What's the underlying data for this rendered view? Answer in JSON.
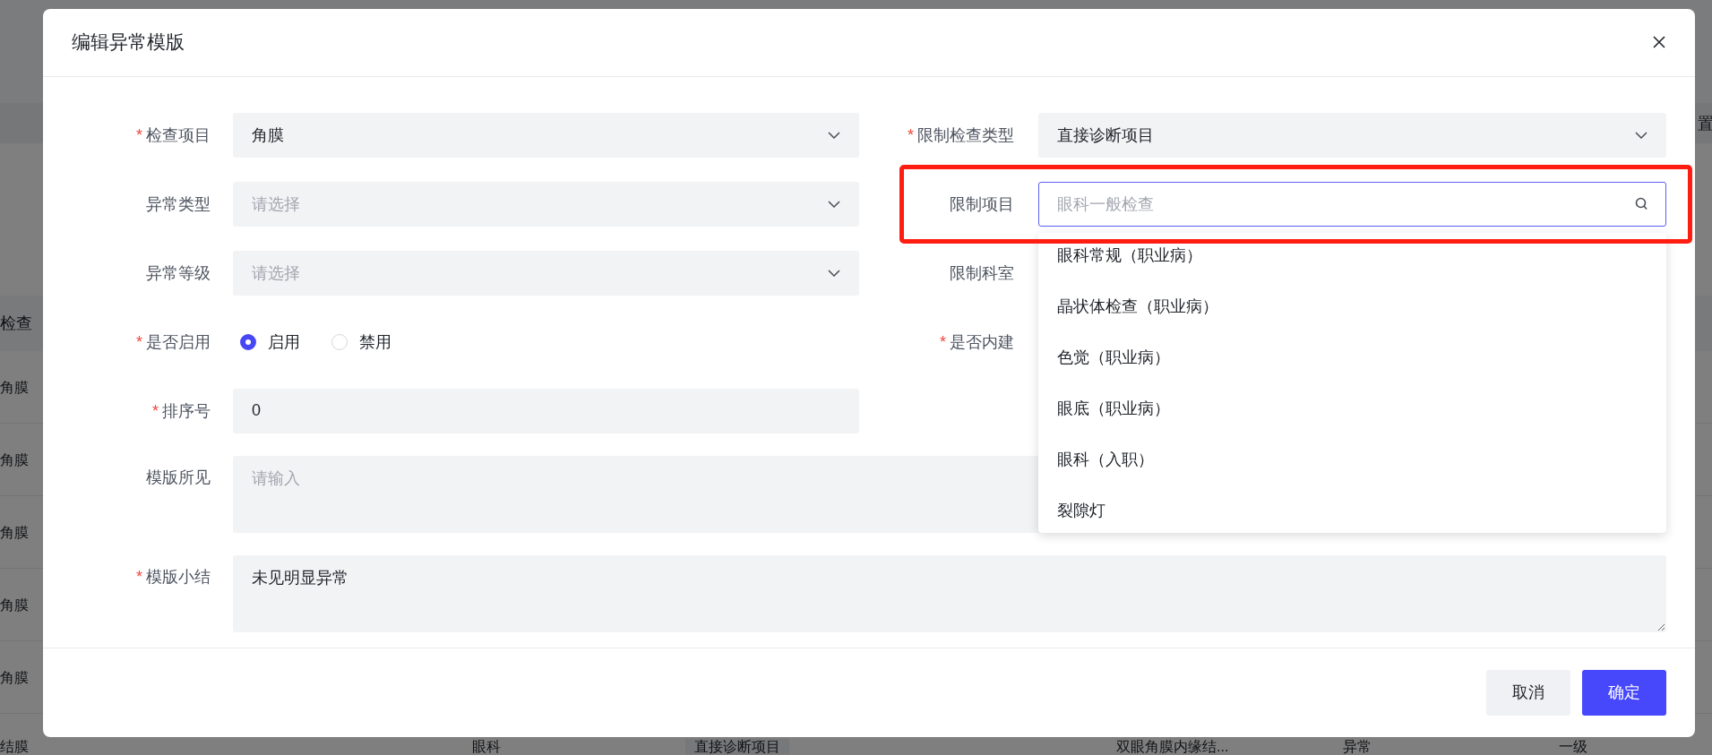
{
  "background": {
    "toolbar_text": "置",
    "table": {
      "header": "检查",
      "rows": [
        {
          "cells": [
            "角膜"
          ]
        },
        {
          "cells": [
            "角膜"
          ]
        },
        {
          "cells": [
            "角膜"
          ]
        },
        {
          "cells": [
            "角膜"
          ]
        },
        {
          "cells": [
            "角膜"
          ]
        },
        {
          "cells": [
            "结膜",
            "眼科",
            "直接诊断项目",
            "双眼角膜内缘结...",
            "异常",
            "一级"
          ]
        }
      ]
    }
  },
  "dialog": {
    "title": "编辑异常模版",
    "fields_left": [
      {
        "kind": "select",
        "label": "检查项目",
        "required_mark": "*",
        "value": "角膜"
      },
      {
        "kind": "select",
        "label": "异常类型",
        "placeholder": "请选择"
      },
      {
        "kind": "select",
        "label": "异常等级",
        "placeholder": "请选择"
      },
      {
        "kind": "radio",
        "label": "是否启用",
        "required_mark": "*",
        "options": [
          {
            "label": "启用",
            "selected": true
          },
          {
            "label": "禁用",
            "selected": false
          }
        ]
      },
      {
        "kind": "input",
        "label": "排序号",
        "required_mark": "*",
        "value": "0"
      }
    ],
    "fields_right": [
      {
        "kind": "select",
        "label": "限制检查类型",
        "required_mark": "*",
        "value": "直接诊断项目"
      },
      {
        "kind": "search",
        "label": "限制项目",
        "placeholder": "眼科一般检查",
        "focused": true,
        "highlighted": true,
        "options": [
          "眼科常规（职业病）",
          "晶状体检查（职业病）",
          "色觉（职业病）",
          "眼底（职业病）",
          "眼科（入职）",
          "裂隙灯"
        ]
      },
      {
        "kind": "label",
        "label": "限制科室"
      },
      {
        "kind": "label",
        "label": "是否内建",
        "required_mark": "*"
      }
    ],
    "fields_full": [
      {
        "kind": "textarea",
        "label": "模版所见",
        "placeholder": "请输入"
      },
      {
        "kind": "textarea",
        "label": "模版小结",
        "required_mark": "*",
        "value": "未见明显异常"
      }
    ],
    "buttons": [
      {
        "kind": "secondary",
        "label": "取消"
      },
      {
        "kind": "primary",
        "label": "确定"
      }
    ]
  }
}
